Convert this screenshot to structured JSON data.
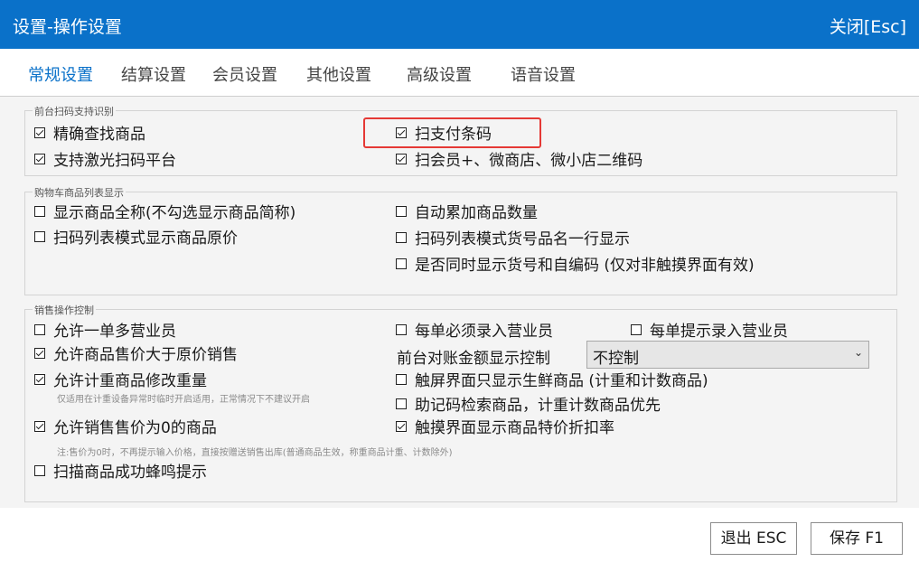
{
  "window": {
    "title": "设置-操作设置",
    "close_label": "关闭[Esc]"
  },
  "tabs": [
    "常规设置",
    "结算设置",
    "会员设置",
    "其他设置",
    "高级设置",
    "语音设置"
  ],
  "active_tab": "常规设置",
  "groups": {
    "scan": {
      "legend": "前台扫码支持识别",
      "precise_search": {
        "label": "精确查找商品",
        "checked": true
      },
      "pay_barcode": {
        "label": "扫支付条码",
        "checked": true
      },
      "laser_scan": {
        "label": "支持激光扫码平台",
        "checked": true
      },
      "member_qr": {
        "label": "扫会员+、微商店、微小店二维码",
        "checked": true
      }
    },
    "cart": {
      "legend": "购物车商品列表显示",
      "full_name": {
        "label": "显示商品全称(不勾选显示商品简称)",
        "checked": false
      },
      "auto_accumulate": {
        "label": "自动累加商品数量",
        "checked": false
      },
      "original_price": {
        "label": "扫码列表模式显示商品原价",
        "checked": false
      },
      "one_line": {
        "label": "扫码列表模式货号品名一行显示",
        "checked": false
      },
      "show_codes": {
        "label": "是否同时显示货号和自编码 (仅对非触摸界面有效)",
        "checked": false
      }
    },
    "sales": {
      "legend": "销售操作控制",
      "multi_clerk": {
        "label": "允许一单多营业员",
        "checked": false
      },
      "must_enter_clerk": {
        "label": "每单必须录入营业员",
        "checked": false
      },
      "prompt_clerk": {
        "label": "每单提示录入营业员",
        "checked": false
      },
      "price_above_original": {
        "label": "允许商品售价大于原价销售",
        "checked": true
      },
      "reconcile_label": "前台对账金额显示控制",
      "reconcile_select": "不控制",
      "modify_weight": {
        "label": "允许计重商品修改重量",
        "checked": true
      },
      "modify_weight_note": "仅适用在计重设备异常时临时开启适用，正常情况下不建议开启",
      "touch_fresh_only": {
        "label": "触屏界面只显示生鲜商品 (计重和计数商品)",
        "checked": false
      },
      "mnemonic_search": {
        "label": "助记码检索商品，计重计数商品优先",
        "checked": false
      },
      "zero_price": {
        "label": "允许销售售价为0的商品",
        "checked": true
      },
      "zero_price_note": "注:售价为0时，不再提示输入价格，直接按赠送销售出库(普通商品生效，称重商品计重、计数除外)",
      "touch_discount": {
        "label": "触摸界面显示商品特价折扣率",
        "checked": true
      },
      "beep": {
        "label": "扫描商品成功蜂鸣提示",
        "checked": false
      }
    }
  },
  "buttons": {
    "exit": "退出 ESC",
    "save": "保存 F1"
  },
  "colors": {
    "title_bar": "#0a71c9",
    "active_tab": "#0a71c9",
    "highlight": "#e53935"
  }
}
